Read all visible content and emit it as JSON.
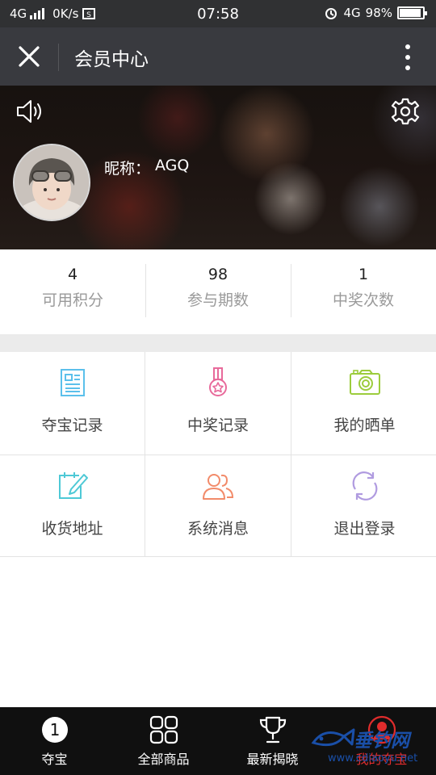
{
  "status_bar": {
    "network_left": "4G",
    "speed": "0K/s",
    "time": "07:58",
    "network_right": "4G",
    "battery": "98%"
  },
  "title_bar": {
    "title": "会员中心"
  },
  "profile": {
    "nickname_label": "昵称：",
    "nickname_value": "AGQ"
  },
  "stats": [
    {
      "value": "4",
      "label": "可用积分"
    },
    {
      "value": "98",
      "label": "参与期数"
    },
    {
      "value": "1",
      "label": "中奖次数"
    }
  ],
  "menu": [
    {
      "label": "夺宝记录",
      "icon": "newspaper-icon",
      "color": "#5bc0eb"
    },
    {
      "label": "中奖记录",
      "icon": "medal-icon",
      "color": "#e86a9b"
    },
    {
      "label": "我的晒单",
      "icon": "camera-icon",
      "color": "#9ccc3c"
    },
    {
      "label": "收货地址",
      "icon": "edit-calendar-icon",
      "color": "#4ec9d6"
    },
    {
      "label": "系统消息",
      "icon": "users-icon",
      "color": "#f28b6a"
    },
    {
      "label": "退出登录",
      "icon": "refresh-icon",
      "color": "#b09be0"
    }
  ],
  "bottom_nav": [
    {
      "label": "夺宝",
      "icon": "number-one-icon",
      "badge": "1"
    },
    {
      "label": "全部商品",
      "icon": "grid-icon"
    },
    {
      "label": "最新揭晓",
      "icon": "trophy-icon"
    },
    {
      "label": "我的夺宝",
      "icon": "user-icon",
      "active": true
    }
  ],
  "watermark": {
    "text": "垂钓网",
    "url": "www.cdiaoyu.net"
  },
  "colors": {
    "title_bar": "#393a3f",
    "status_bar": "#303133",
    "bottom_nav": "#101010",
    "active": "#e02c2c"
  }
}
